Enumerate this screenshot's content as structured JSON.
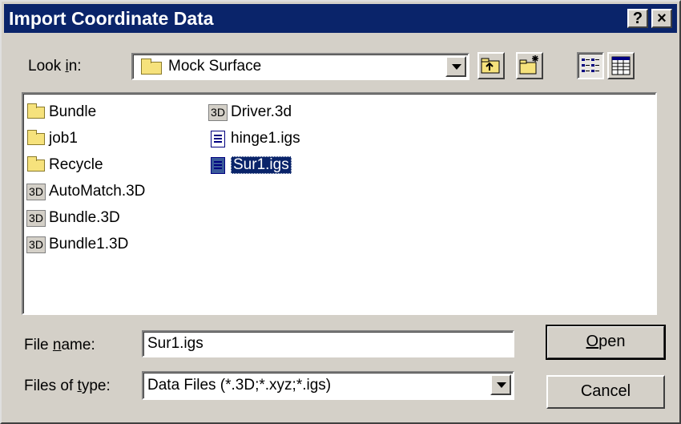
{
  "window": {
    "title": "Import Coordinate Data",
    "help_label": "?",
    "close_label": "×"
  },
  "look_in": {
    "label_pre": "Look ",
    "label_key": "i",
    "label_post": "n:",
    "value": "Mock Surface",
    "icon": "folder-icon"
  },
  "toolbar": {
    "up_icon": "up-one-level-icon",
    "new_folder_icon": "new-folder-icon",
    "list_icon": "list-view-icon",
    "details_icon": "details-view-icon"
  },
  "files": [
    {
      "name": "Bundle",
      "type": "folder"
    },
    {
      "name": "job1",
      "type": "folder"
    },
    {
      "name": "Recycle",
      "type": "folder"
    },
    {
      "name": "AutoMatch.3D",
      "type": "3d"
    },
    {
      "name": "Bundle.3D",
      "type": "3d"
    },
    {
      "name": "Bundle1.3D",
      "type": "3d"
    },
    {
      "name": "Driver.3d",
      "type": "3d"
    },
    {
      "name": "hinge1.igs",
      "type": "igs"
    },
    {
      "name": "Sur1.igs",
      "type": "igs",
      "selected": true
    }
  ],
  "icon_text_3d": "3D",
  "file_name": {
    "label_pre": "File ",
    "label_key": "n",
    "label_post": "ame:",
    "value": "Sur1.igs"
  },
  "file_type": {
    "label_pre": "Files of ",
    "label_key": "t",
    "label_post": "ype:",
    "value": "Data Files (*.3D;*.xyz;*.igs)"
  },
  "buttons": {
    "open_key": "O",
    "open_rest": "pen",
    "cancel": "Cancel"
  },
  "colors": {
    "titlebar": "#0a246a",
    "face": "#d4d0c8",
    "selection": "#0a246a"
  }
}
